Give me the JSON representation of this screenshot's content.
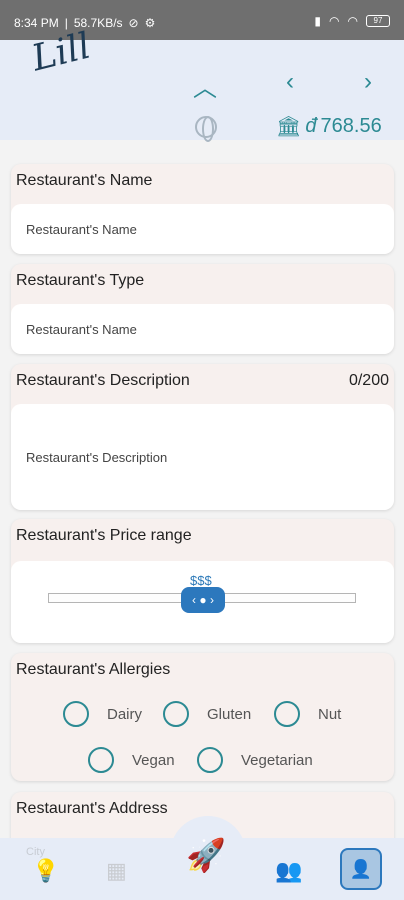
{
  "status_bar": {
    "time": "8:34 PM",
    "speed": "58.7KB/s",
    "battery": "97"
  },
  "header": {
    "logo_text": "Lill",
    "balance": "768.56",
    "currency_symbol": "đ"
  },
  "form": {
    "name": {
      "label": "Restaurant's Name",
      "placeholder": "Restaurant's Name"
    },
    "type": {
      "label": "Restaurant's Type",
      "placeholder": "Restaurant's Name"
    },
    "description": {
      "label": "Restaurant's Description",
      "counter": "0/200",
      "placeholder": "Restaurant's Description"
    },
    "price": {
      "label": "Restaurant's Price range",
      "value": "$$$",
      "level": 3,
      "max": 5
    },
    "allergies": {
      "label": "Restaurant's Allergies",
      "options": [
        "Dairy",
        "Gluten",
        "Nut",
        "Vegan",
        "Vegetarian"
      ]
    },
    "address": {
      "label": "Restaurant's Address"
    }
  },
  "bottom_nav": {
    "city_label": "City"
  },
  "colors": {
    "accent": "#2c8a93",
    "primary_blue": "#2c78bd",
    "header_bg": "#e6ecf7",
    "card_bg": "#f7f0ee"
  }
}
